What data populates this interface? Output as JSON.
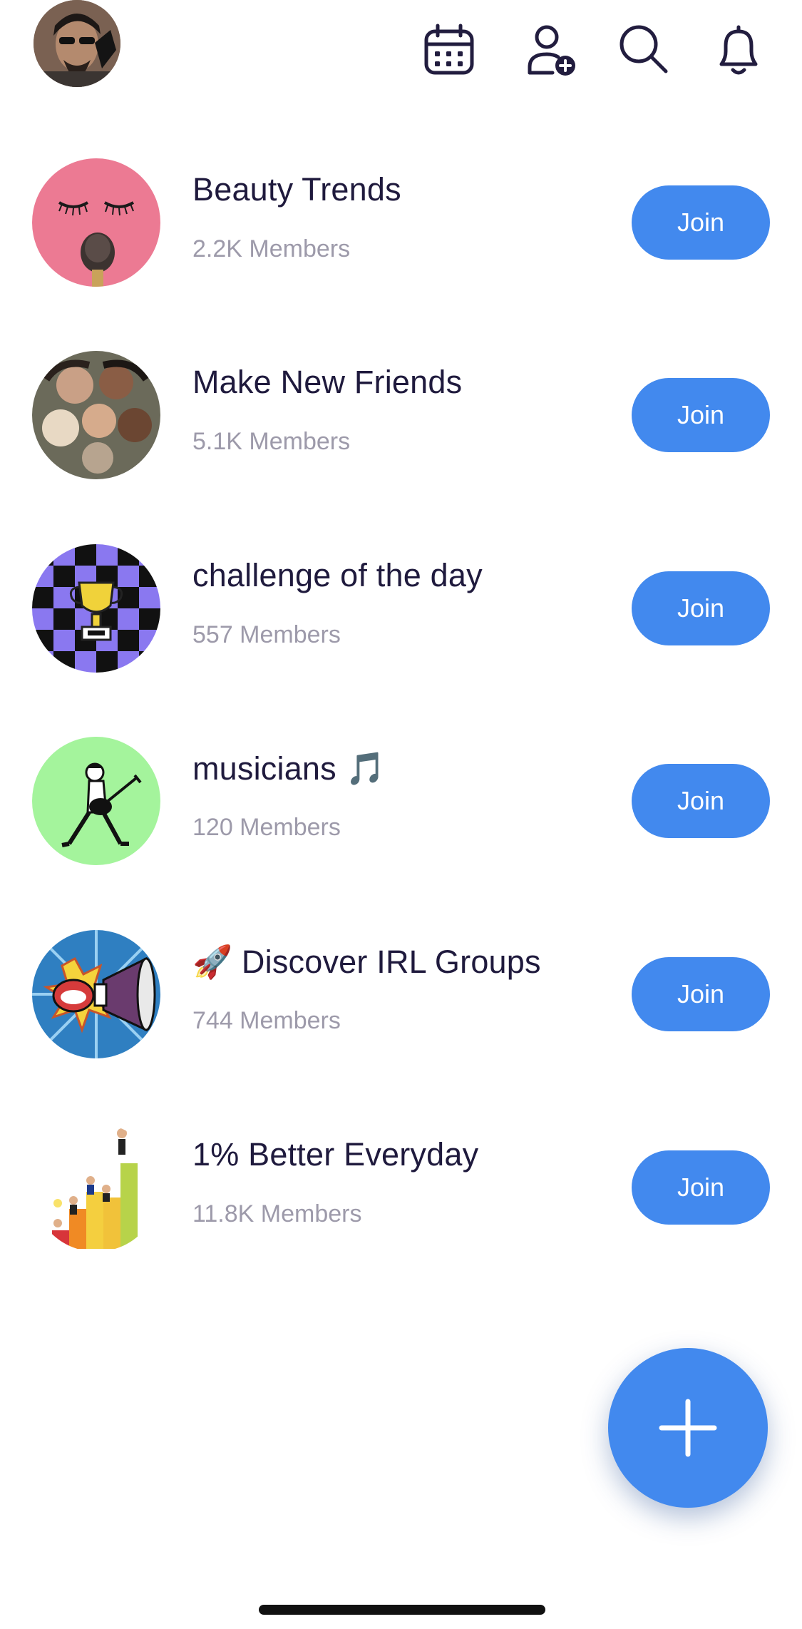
{
  "header": {
    "icons": [
      "calendar-icon",
      "add-user-icon",
      "search-icon",
      "bell-icon"
    ]
  },
  "groups": [
    {
      "name": "Beauty Trends",
      "members": "2.2K Members",
      "join_label": "Join"
    },
    {
      "name": "Make New Friends",
      "members": "5.1K Members",
      "join_label": "Join"
    },
    {
      "name": "challenge of the day",
      "members": "557 Members",
      "join_label": "Join"
    },
    {
      "name": "musicians 🎵",
      "members": "120 Members",
      "join_label": "Join"
    },
    {
      "name": "🚀 Discover IRL Groups",
      "members": "744 Members",
      "join_label": "Join"
    },
    {
      "name": "1% Better Everyday",
      "members": "11.8K Members",
      "join_label": "Join"
    }
  ],
  "fab": {
    "icon": "plus-icon"
  },
  "colors": {
    "accent": "#4289ee",
    "title_text": "#1f1a3d",
    "secondary_text": "#9d9aaa"
  }
}
